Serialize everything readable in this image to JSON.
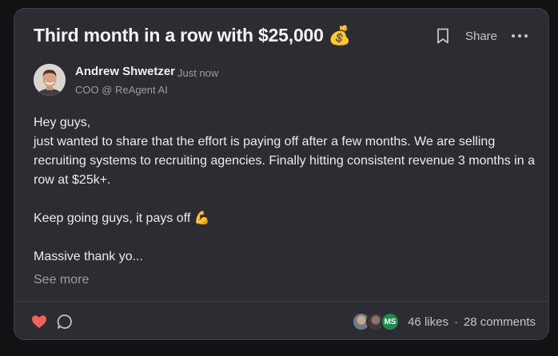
{
  "post": {
    "title": "Third month in a row with $25,000 💰",
    "share_label": "Share",
    "author": {
      "name": "Andrew Shwetzer",
      "timestamp": "Just now",
      "role": "COO @ ReAgent AI"
    },
    "body": {
      "line1": "Hey guys,",
      "line2": "just wanted to share that the effort is paying off after a few months. We are selling recruiting systems to recruiting agencies. Finally hitting consistent revenue 3 months in a row at $25k+.",
      "line3": "Keep going guys, it pays off 💪",
      "line4": "Massive thank yo..."
    },
    "see_more_label": "See more"
  },
  "footer": {
    "liker_initials": "MS",
    "likes": "46 likes",
    "separator": "·",
    "comments": "28 comments"
  },
  "colors": {
    "card_bg": "#2c2c32",
    "page_bg": "#121215",
    "heart": "#f0625a",
    "initials_avatar": "#1e8a4c"
  },
  "icons": {
    "bookmark": "bookmark-icon",
    "more": "more-horizontal-icon",
    "like": "heart-icon",
    "comment": "comment-icon"
  }
}
